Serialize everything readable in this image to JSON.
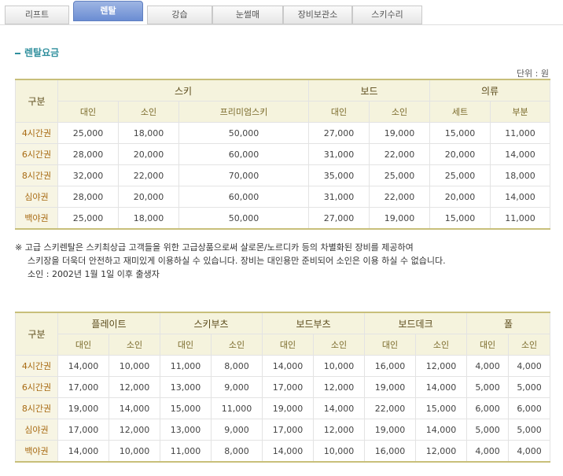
{
  "tabs": [
    {
      "label": "리프트",
      "active": false
    },
    {
      "label": "렌탈",
      "active": true
    },
    {
      "label": "강습",
      "active": false
    },
    {
      "label": "눈썰매",
      "active": false
    },
    {
      "label": "장비보관소",
      "active": false
    },
    {
      "label": "스키수리",
      "active": false
    }
  ],
  "section_title": "렌탈요금",
  "unit": "단위 : 원",
  "table1": {
    "corner": "구분",
    "groups": [
      "스키",
      "보드",
      "의류"
    ],
    "sub": [
      "대인",
      "소인",
      "프리미엄스키",
      "대인",
      "소인",
      "세트",
      "부분"
    ],
    "rows": [
      {
        "label": "4시간권",
        "values": [
          "25,000",
          "18,000",
          "50,000",
          "27,000",
          "19,000",
          "15,000",
          "11,000"
        ]
      },
      {
        "label": "6시간권",
        "values": [
          "28,000",
          "20,000",
          "60,000",
          "31,000",
          "22,000",
          "20,000",
          "14,000"
        ]
      },
      {
        "label": "8시간권",
        "values": [
          "32,000",
          "22,000",
          "70,000",
          "35,000",
          "25,000",
          "25,000",
          "18,000"
        ]
      },
      {
        "label": "심야권",
        "values": [
          "28,000",
          "20,000",
          "60,000",
          "31,000",
          "22,000",
          "20,000",
          "14,000"
        ]
      },
      {
        "label": "백야권",
        "values": [
          "25,000",
          "18,000",
          "50,000",
          "27,000",
          "19,000",
          "15,000",
          "11,000"
        ]
      }
    ]
  },
  "notes": [
    "※ 고급 스키렌탈은 스키최상급 고객들을 위한 고급상품으로써 살로몬/노르디카 등의 차별화된 장비를 제공하여",
    "스키장을 더욱더 안전하고 재미있게 이용하실 수 있습니다. 장비는 대인용만 준비되어 소인은 이용 하실 수 없습니다.",
    "소인 : 2002년 1월 1일 이후 출생자"
  ],
  "table2": {
    "corner": "구분",
    "groups": [
      "플레이트",
      "스키부츠",
      "보드부츠",
      "보드데크",
      "폴"
    ],
    "sub": [
      "대인",
      "소인",
      "대인",
      "소인",
      "대인",
      "소인",
      "대인",
      "소인",
      "대인",
      "소인"
    ],
    "rows": [
      {
        "label": "4시간권",
        "values": [
          "14,000",
          "10,000",
          "11,000",
          "8,000",
          "14,000",
          "10,000",
          "16,000",
          "12,000",
          "4,000",
          "4,000"
        ]
      },
      {
        "label": "6시간권",
        "values": [
          "17,000",
          "12,000",
          "13,000",
          "9,000",
          "17,000",
          "12,000",
          "19,000",
          "14,000",
          "5,000",
          "5,000"
        ]
      },
      {
        "label": "8시간권",
        "values": [
          "19,000",
          "14,000",
          "15,000",
          "11,000",
          "19,000",
          "14,000",
          "22,000",
          "15,000",
          "6,000",
          "6,000"
        ]
      },
      {
        "label": "심야권",
        "values": [
          "17,000",
          "12,000",
          "13,000",
          "9,000",
          "17,000",
          "12,000",
          "19,000",
          "14,000",
          "5,000",
          "5,000"
        ]
      },
      {
        "label": "백야권",
        "values": [
          "14,000",
          "10,000",
          "11,000",
          "8,000",
          "14,000",
          "10,000",
          "16,000",
          "12,000",
          "4,000",
          "4,000"
        ]
      }
    ]
  }
}
